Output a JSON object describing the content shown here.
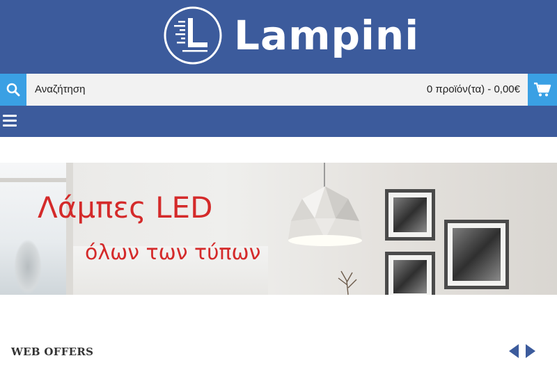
{
  "brand": {
    "name": "Lampini"
  },
  "search": {
    "placeholder": "Αναζήτηση",
    "icon": "search-icon"
  },
  "cart": {
    "summary": "0 προϊόν(τα) - 0,00€",
    "icon": "cart-icon"
  },
  "nav": {
    "menu_icon": "hamburger-menu-icon"
  },
  "banner": {
    "title": "Λάμπες LED",
    "subtitle": "όλων των τύπων"
  },
  "offers": {
    "title": "WEB OFFERS"
  },
  "colors": {
    "header_bg": "#3c5b9c",
    "accent": "#3aa0e4",
    "banner_text": "#d42a2a"
  }
}
